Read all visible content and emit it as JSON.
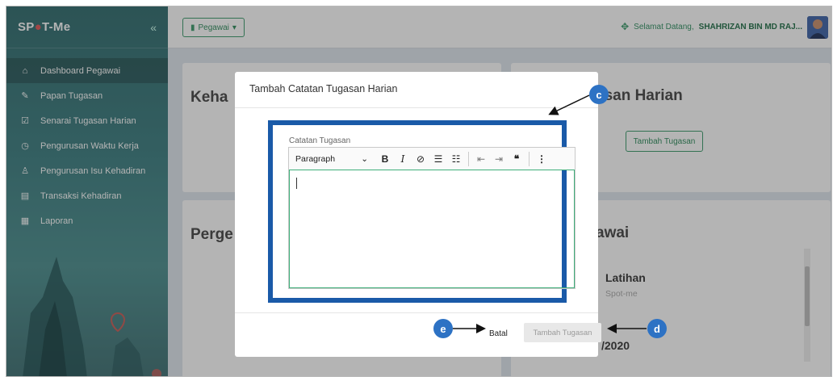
{
  "app": {
    "logo_text_pre": "SP",
    "logo_text_post": "T-Me",
    "collapse_icon": "«",
    "brand_color": "#3a7d80"
  },
  "sidebar": {
    "items": [
      {
        "label": "Dashboard Pegawai",
        "icon": "home-icon",
        "active": true
      },
      {
        "label": "Papan Tugasan",
        "icon": "tasks-icon"
      },
      {
        "label": "Senarai Tugasan Harian",
        "icon": "checklist-icon"
      },
      {
        "label": "Pengurusan Waktu Kerja",
        "icon": "clock-icon"
      },
      {
        "label": "Pengurusan Isu Kehadiran",
        "icon": "user-icon"
      },
      {
        "label": "Transaksi Kehadiran",
        "icon": "list-icon"
      },
      {
        "label": "Laporan",
        "icon": "report-icon"
      }
    ]
  },
  "topbar": {
    "role_select": "Pegawai",
    "welcome_prefix": "Selamat Datang,",
    "user_name": "SHAHRIZAN BIN MD RAJ..."
  },
  "cards": {
    "kehadiran_title": "Keha",
    "tugasan_title": "asan Harian",
    "tambah_tugasan_label": "Tambah Tugasan",
    "pergerakan_title": "Perge",
    "pegawai_title": "awai",
    "latihan_title": "Latihan",
    "latihan_sub": "Spot-me",
    "date_fragment": "/2020"
  },
  "modal": {
    "title": "Tambah Catatan Tugasan Harian",
    "field_label": "Catatan Tugasan",
    "paragraph_select": "Paragraph",
    "cancel_label": "Batal",
    "submit_label": "Tambah Tugasan"
  },
  "annotations": {
    "c": "c",
    "d": "d",
    "e": "e"
  }
}
